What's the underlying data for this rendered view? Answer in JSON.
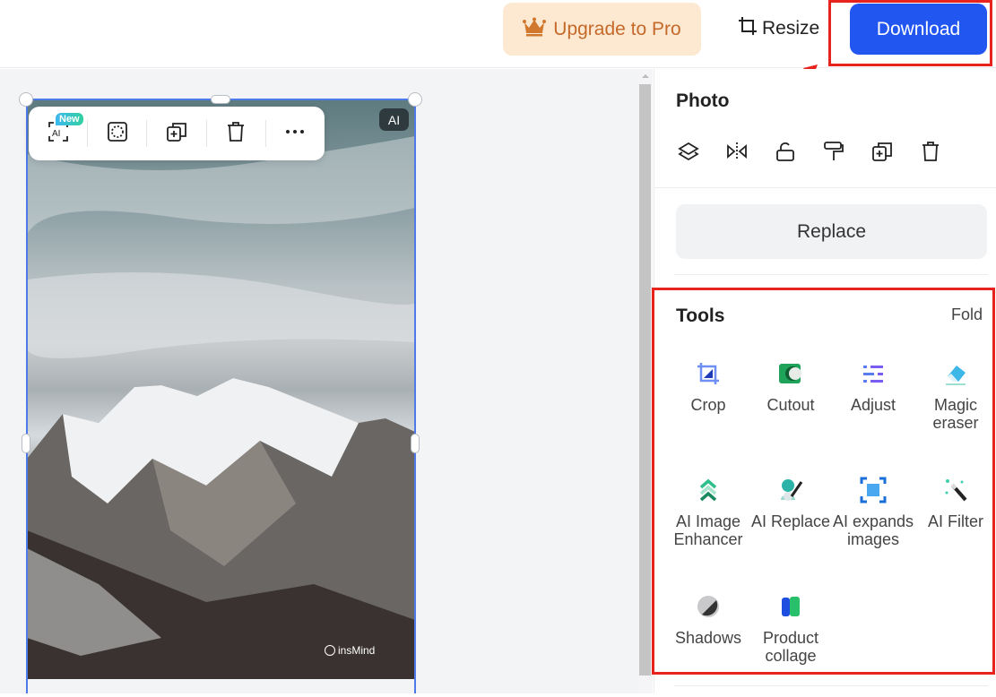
{
  "header": {
    "upgrade_label": "Upgrade to Pro",
    "resize_label": "Resize",
    "download_label": "Download"
  },
  "canvas": {
    "toolbar": {
      "new_badge": "New",
      "ai_icon_text": "AI",
      "items": [
        "ai-tools",
        "select-area",
        "duplicate",
        "delete",
        "more"
      ]
    },
    "ai_badge": "AI",
    "watermark": "insMind"
  },
  "panel": {
    "title": "Photo",
    "icons": [
      "layers",
      "flip",
      "unlock",
      "paint-roller",
      "duplicate",
      "delete"
    ],
    "replace_label": "Replace",
    "tools": {
      "title": "Tools",
      "fold_label": "Fold",
      "items": [
        {
          "id": "crop",
          "label": "Crop"
        },
        {
          "id": "cutout",
          "label": "Cutout"
        },
        {
          "id": "adjust",
          "label": "Adjust"
        },
        {
          "id": "magic-eraser",
          "label": "Magic eraser"
        },
        {
          "id": "ai-image-enhancer",
          "label": "AI Image Enhancer"
        },
        {
          "id": "ai-replace",
          "label": "AI Replace"
        },
        {
          "id": "ai-expands-images",
          "label": "AI expands images"
        },
        {
          "id": "ai-filter",
          "label": "AI Filter"
        },
        {
          "id": "shadows",
          "label": "Shadows"
        },
        {
          "id": "product-collage",
          "label": "Product collage"
        }
      ]
    }
  },
  "colors": {
    "download": "#2156f0",
    "upgrade_bg": "#fde9d2",
    "upgrade_text": "#c4692a",
    "highlight": "#e8231e",
    "selection": "#4d7ae8"
  }
}
